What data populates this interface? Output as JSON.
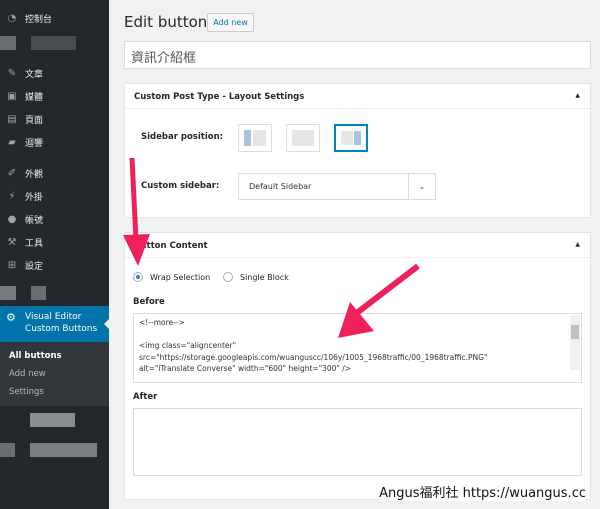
{
  "sidebar": {
    "items": [
      {
        "icon": "dashboard-icon",
        "label": "控制台"
      },
      {
        "icon": "pin-icon",
        "label": "文章"
      },
      {
        "icon": "media-icon",
        "label": "媒體"
      },
      {
        "icon": "pages-icon",
        "label": "頁面"
      },
      {
        "icon": "comments-icon",
        "label": "迴響"
      },
      {
        "icon": "appearance-icon",
        "label": "外觀"
      },
      {
        "icon": "plugins-icon",
        "label": "外掛"
      },
      {
        "icon": "users-icon",
        "label": "帳號"
      },
      {
        "icon": "tools-icon",
        "label": "工具"
      },
      {
        "icon": "settings-icon",
        "label": "設定"
      }
    ],
    "active": {
      "icon": "gear-icon",
      "line1": "Visual Editor",
      "line2": "Custom Buttons"
    },
    "submenu": [
      "All buttons",
      "Add new",
      "Settings"
    ]
  },
  "header": {
    "title": "Edit button",
    "add_new": "Add new"
  },
  "post_title": "資訊介紹框",
  "layout_panel": {
    "title": "Custom Post Type - Layout Settings",
    "sidebar_position_label": "Sidebar position:",
    "selected_position": "right",
    "custom_sidebar_label": "Custom sidebar:",
    "custom_sidebar_value": "Default Sidebar"
  },
  "content_panel": {
    "title": "Button Content",
    "radio_wrap": "Wrap Selection",
    "radio_single": "Single Block",
    "selected": "Wrap Selection",
    "before_label": "Before",
    "before_value": "<!--more-->\n\n<img class=\"aligncenter\"\nsrc=\"https://storage.googleapis.com/wuanguscc/106y/1005_1968traffic/00_1968traffic.PNG\"\nalt=\"iTranslate Converse\" width=\"600\" height=\"300\" />",
    "after_label": "After",
    "after_value": ""
  },
  "watermark": "Angus福利社 https://wuangus.cc",
  "colors": {
    "sidebar": "#23282d",
    "active": "#0073aa",
    "arrow": "#f0205a"
  }
}
